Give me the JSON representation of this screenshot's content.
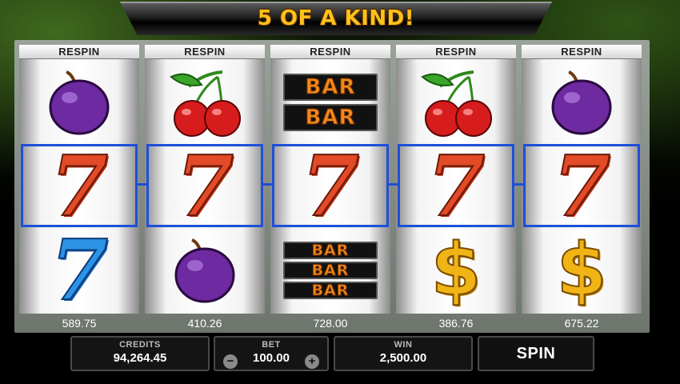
{
  "banner": {
    "text": "5 OF A KIND!"
  },
  "reels": [
    {
      "header": "RESPIN",
      "value": "589.75",
      "symbols": [
        "plum",
        "seven-red",
        "seven-blue"
      ]
    },
    {
      "header": "RESPIN",
      "value": "410.26",
      "symbols": [
        "cherries",
        "seven-red",
        "plum"
      ]
    },
    {
      "header": "RESPIN",
      "value": "728.00",
      "symbols": [
        "bar-double",
        "seven-red",
        "bar-triple"
      ]
    },
    {
      "header": "RESPIN",
      "value": "386.76",
      "symbols": [
        "cherries",
        "seven-red",
        "dollar"
      ]
    },
    {
      "header": "RESPIN",
      "value": "675.22",
      "symbols": [
        "plum",
        "seven-red",
        "dollar"
      ]
    }
  ],
  "symbols": {
    "seven": "7",
    "bar": "BAR",
    "dollar": "$"
  },
  "credits": {
    "label": "CREDITS",
    "value": "94,264.45"
  },
  "bet": {
    "label": "BET",
    "value": "100.00",
    "minus": "−",
    "plus": "+"
  },
  "win": {
    "label": "WIN",
    "value": "2,500.00"
  },
  "spin": {
    "label": "SPIN"
  },
  "colors": {
    "win_line": "#1d4fd8",
    "seven_red": "#e24a28",
    "seven_blue": "#2c93e6",
    "dollar": "#f0b417",
    "bar": "#f08a1b",
    "banner": "#ffc21a"
  }
}
